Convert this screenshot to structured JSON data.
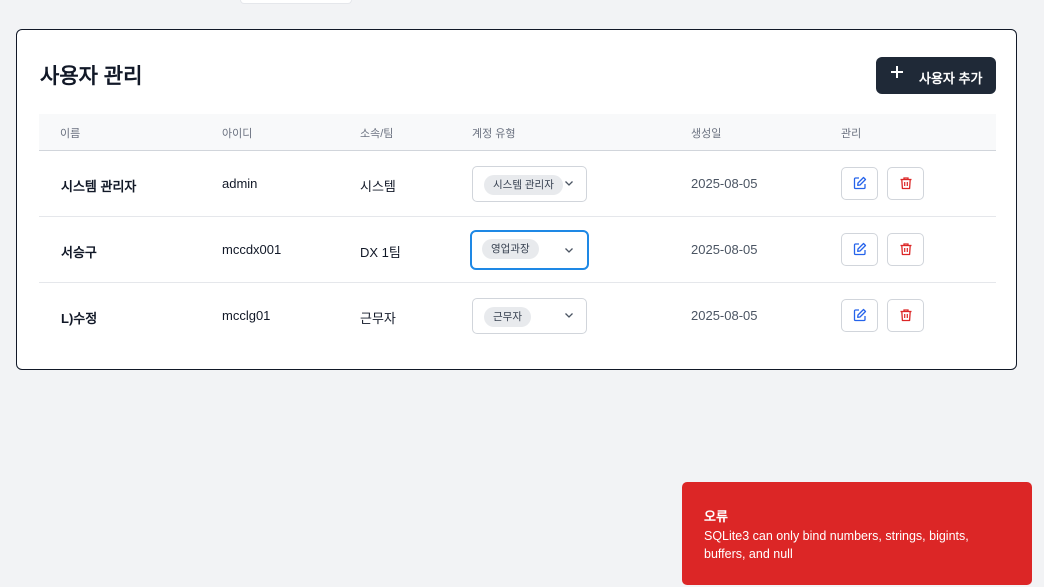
{
  "page": {
    "title": "사용자 관리",
    "add_button_label": "사용자 추가"
  },
  "table": {
    "headers": [
      "이름",
      "아이디",
      "소속/팀",
      "계정 유형",
      "생성일",
      "관리"
    ],
    "rows": [
      {
        "name": "시스템 관리자",
        "username": "admin",
        "team": "시스템",
        "role": "시스템 관리자",
        "created": "2025-08-05"
      },
      {
        "name": "서승구",
        "username": "mccdx001",
        "team": "DX 1팀",
        "role": "영업과장",
        "created": "2025-08-05"
      },
      {
        "name": "L)수정",
        "username": "mcclg01",
        "team": "근무자",
        "role": "근무자",
        "created": "2025-08-05"
      }
    ]
  },
  "toast": {
    "title": "오류",
    "message": "SQLite3 can only bind numbers, strings, bigints, buffers, and null"
  },
  "icons": {
    "add": "plus-icon",
    "edit": "edit-icon",
    "delete": "trash-icon",
    "dropdown": "chevron-down-icon"
  },
  "colors": {
    "primary_button": "#1f2937",
    "edit_icon": "#2563eb",
    "delete_icon": "#dc2626",
    "toast_background": "#dc2626",
    "focus_ring": "#1e88e5"
  }
}
